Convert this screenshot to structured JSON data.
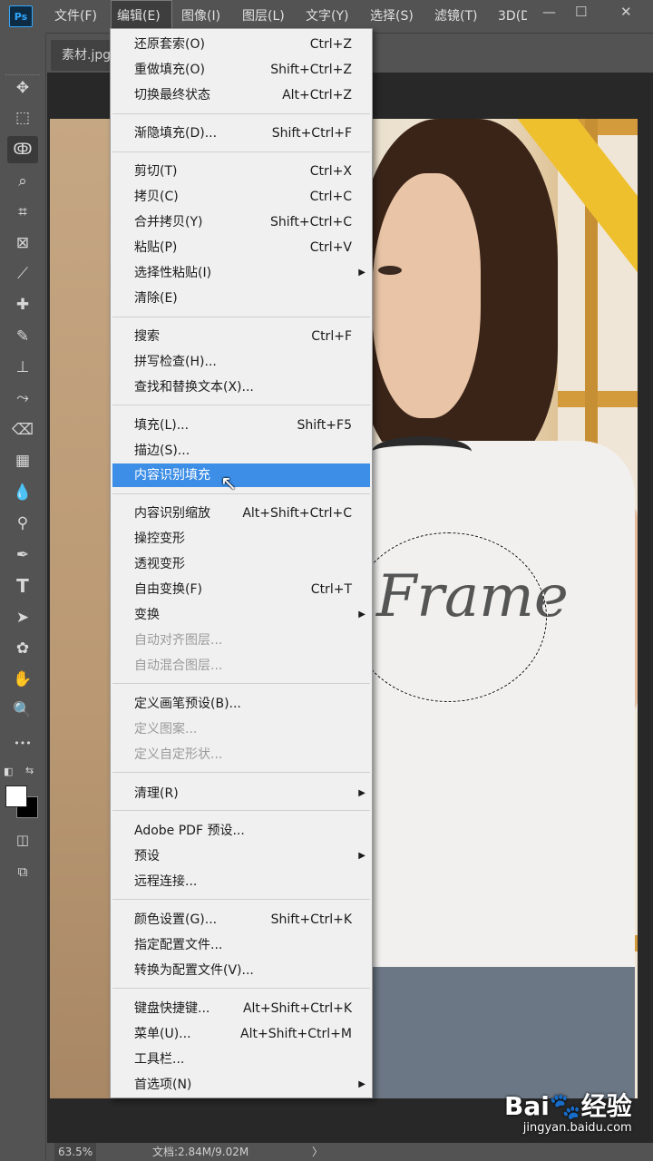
{
  "app": {
    "logo": "Ps"
  },
  "menubar": {
    "items": [
      "文件(F)",
      "编辑(E)",
      "图像(I)",
      "图层(L)",
      "文字(Y)",
      "选择(S)",
      "滤镜(T)",
      "3D(D"
    ],
    "active": "编辑(E)",
    "window_controls": {
      "minimize": "—",
      "restore": "☐",
      "close": "✕"
    }
  },
  "document": {
    "tab_title": "素材.jpg",
    "shirt_text": "Frame"
  },
  "toolbar": {
    "tools": [
      {
        "name": "move-tool-icon",
        "glyph": "✥"
      },
      {
        "name": "marquee-tool-icon",
        "glyph": "⬚"
      },
      {
        "name": "lasso-tool-icon",
        "glyph": "ↂ"
      },
      {
        "name": "quick-select-tool-icon",
        "glyph": "⌕"
      },
      {
        "name": "crop-tool-icon",
        "glyph": "⌗"
      },
      {
        "name": "frame-tool-icon",
        "glyph": "⊠"
      },
      {
        "name": "eyedropper-tool-icon",
        "glyph": "⟋"
      },
      {
        "name": "healing-brush-tool-icon",
        "glyph": "✚"
      },
      {
        "name": "brush-tool-icon",
        "glyph": "✎"
      },
      {
        "name": "clone-stamp-tool-icon",
        "glyph": "⊥"
      },
      {
        "name": "history-brush-tool-icon",
        "glyph": "⤳"
      },
      {
        "name": "eraser-tool-icon",
        "glyph": "⌫"
      },
      {
        "name": "gradient-tool-icon",
        "glyph": "▦"
      },
      {
        "name": "blur-tool-icon",
        "glyph": "💧"
      },
      {
        "name": "dodge-tool-icon",
        "glyph": "⚲"
      },
      {
        "name": "pen-tool-icon",
        "glyph": "✒"
      },
      {
        "name": "type-tool-icon",
        "glyph": "T"
      },
      {
        "name": "path-selection-tool-icon",
        "glyph": "➤"
      },
      {
        "name": "custom-shape-tool-icon",
        "glyph": "✿"
      },
      {
        "name": "hand-tool-icon",
        "glyph": "✋"
      },
      {
        "name": "zoom-tool-icon",
        "glyph": "🔍"
      },
      {
        "name": "more-tools-icon",
        "glyph": "•••"
      }
    ],
    "mode_icons": [
      {
        "name": "quick-mask-icon",
        "glyph": "◫"
      },
      {
        "name": "screen-mode-icon",
        "glyph": "⧉"
      }
    ],
    "selected_tool": "lasso-tool-icon"
  },
  "edit_menu": {
    "items": [
      {
        "label": "还原套索(O)",
        "shortcut": "Ctrl+Z"
      },
      {
        "label": "重做填充(O)",
        "shortcut": "Shift+Ctrl+Z"
      },
      {
        "label": "切换最终状态",
        "shortcut": "Alt+Ctrl+Z"
      },
      {
        "label": "渐隐填充(D)...",
        "shortcut": "Shift+Ctrl+F"
      },
      {
        "label": "剪切(T)",
        "shortcut": "Ctrl+X"
      },
      {
        "label": "拷贝(C)",
        "shortcut": "Ctrl+C"
      },
      {
        "label": "合并拷贝(Y)",
        "shortcut": "Shift+Ctrl+C"
      },
      {
        "label": "粘贴(P)",
        "shortcut": "Ctrl+V"
      },
      {
        "label": "选择性粘贴(I)",
        "shortcut": "",
        "submenu": true
      },
      {
        "label": "清除(E)",
        "shortcut": ""
      },
      {
        "label": "搜索",
        "shortcut": "Ctrl+F"
      },
      {
        "label": "拼写检查(H)...",
        "shortcut": ""
      },
      {
        "label": "查找和替换文本(X)...",
        "shortcut": ""
      },
      {
        "label": "填充(L)...",
        "shortcut": "Shift+F5"
      },
      {
        "label": "描边(S)...",
        "shortcut": ""
      },
      {
        "label": "内容识别填充",
        "shortcut": "",
        "highlight": true
      },
      {
        "label": "内容识别缩放",
        "shortcut": "Alt+Shift+Ctrl+C"
      },
      {
        "label": "操控变形",
        "shortcut": ""
      },
      {
        "label": "透视变形",
        "shortcut": ""
      },
      {
        "label": "自由变换(F)",
        "shortcut": "Ctrl+T"
      },
      {
        "label": "变换",
        "shortcut": "",
        "submenu": true
      },
      {
        "label": "自动对齐图层...",
        "shortcut": "",
        "disabled": true
      },
      {
        "label": "自动混合图层...",
        "shortcut": "",
        "disabled": true
      },
      {
        "label": "定义画笔预设(B)...",
        "shortcut": ""
      },
      {
        "label": "定义图案...",
        "shortcut": "",
        "disabled": true
      },
      {
        "label": "定义自定形状...",
        "shortcut": "",
        "disabled": true
      },
      {
        "label": "清理(R)",
        "shortcut": "",
        "submenu": true
      },
      {
        "label": "Adobe PDF 预设...",
        "shortcut": ""
      },
      {
        "label": "预设",
        "shortcut": "",
        "submenu": true
      },
      {
        "label": "远程连接...",
        "shortcut": ""
      },
      {
        "label": "颜色设置(G)...",
        "shortcut": "Shift+Ctrl+K"
      },
      {
        "label": "指定配置文件...",
        "shortcut": ""
      },
      {
        "label": "转换为配置文件(V)...",
        "shortcut": ""
      },
      {
        "label": "键盘快捷键...",
        "shortcut": "Alt+Shift+Ctrl+K"
      },
      {
        "label": "菜单(U)...",
        "shortcut": "Alt+Shift+Ctrl+M"
      },
      {
        "label": "工具栏...",
        "shortcut": ""
      },
      {
        "label": "首选项(N)",
        "shortcut": "",
        "submenu": true
      }
    ],
    "submenu_arrow": "▶"
  },
  "status": {
    "zoom": "63.5%",
    "doc_size": "文档:2.84M/9.02M",
    "arrow": "〉"
  },
  "watermark": {
    "logo": "Bai🐾经验",
    "url": "jingyan.baidu.com"
  },
  "colors": {
    "accent": "#3d8ee6",
    "ui_bg": "#535353",
    "foreground_swatch": "#ffffff",
    "background_swatch": "#000000"
  }
}
